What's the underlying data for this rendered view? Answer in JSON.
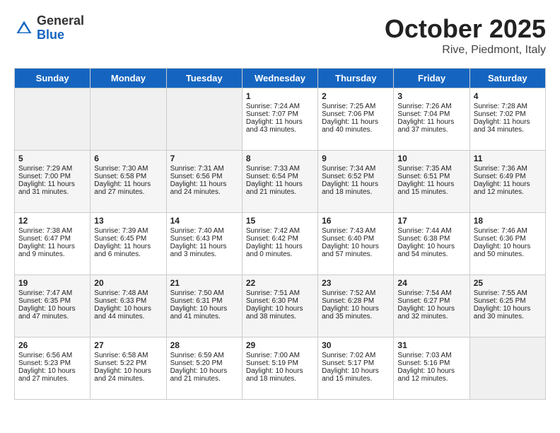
{
  "header": {
    "logo_general": "General",
    "logo_blue": "Blue",
    "month_title": "October 2025",
    "location": "Rive, Piedmont, Italy"
  },
  "days_of_week": [
    "Sunday",
    "Monday",
    "Tuesday",
    "Wednesday",
    "Thursday",
    "Friday",
    "Saturday"
  ],
  "weeks": [
    {
      "cells": [
        {
          "empty": true
        },
        {
          "empty": true
        },
        {
          "empty": true
        },
        {
          "day": 1,
          "sunrise": "7:24 AM",
          "sunset": "7:07 PM",
          "daylight": "11 hours and 43 minutes."
        },
        {
          "day": 2,
          "sunrise": "7:25 AM",
          "sunset": "7:06 PM",
          "daylight": "11 hours and 40 minutes."
        },
        {
          "day": 3,
          "sunrise": "7:26 AM",
          "sunset": "7:04 PM",
          "daylight": "11 hours and 37 minutes."
        },
        {
          "day": 4,
          "sunrise": "7:28 AM",
          "sunset": "7:02 PM",
          "daylight": "11 hours and 34 minutes."
        }
      ]
    },
    {
      "cells": [
        {
          "day": 5,
          "sunrise": "7:29 AM",
          "sunset": "7:00 PM",
          "daylight": "11 hours and 31 minutes."
        },
        {
          "day": 6,
          "sunrise": "7:30 AM",
          "sunset": "6:58 PM",
          "daylight": "11 hours and 27 minutes."
        },
        {
          "day": 7,
          "sunrise": "7:31 AM",
          "sunset": "6:56 PM",
          "daylight": "11 hours and 24 minutes."
        },
        {
          "day": 8,
          "sunrise": "7:33 AM",
          "sunset": "6:54 PM",
          "daylight": "11 hours and 21 minutes."
        },
        {
          "day": 9,
          "sunrise": "7:34 AM",
          "sunset": "6:52 PM",
          "daylight": "11 hours and 18 minutes."
        },
        {
          "day": 10,
          "sunrise": "7:35 AM",
          "sunset": "6:51 PM",
          "daylight": "11 hours and 15 minutes."
        },
        {
          "day": 11,
          "sunrise": "7:36 AM",
          "sunset": "6:49 PM",
          "daylight": "11 hours and 12 minutes."
        }
      ]
    },
    {
      "cells": [
        {
          "day": 12,
          "sunrise": "7:38 AM",
          "sunset": "6:47 PM",
          "daylight": "11 hours and 9 minutes."
        },
        {
          "day": 13,
          "sunrise": "7:39 AM",
          "sunset": "6:45 PM",
          "daylight": "11 hours and 6 minutes."
        },
        {
          "day": 14,
          "sunrise": "7:40 AM",
          "sunset": "6:43 PM",
          "daylight": "11 hours and 3 minutes."
        },
        {
          "day": 15,
          "sunrise": "7:42 AM",
          "sunset": "6:42 PM",
          "daylight": "11 hours and 0 minutes."
        },
        {
          "day": 16,
          "sunrise": "7:43 AM",
          "sunset": "6:40 PM",
          "daylight": "10 hours and 57 minutes."
        },
        {
          "day": 17,
          "sunrise": "7:44 AM",
          "sunset": "6:38 PM",
          "daylight": "10 hours and 54 minutes."
        },
        {
          "day": 18,
          "sunrise": "7:46 AM",
          "sunset": "6:36 PM",
          "daylight": "10 hours and 50 minutes."
        }
      ]
    },
    {
      "cells": [
        {
          "day": 19,
          "sunrise": "7:47 AM",
          "sunset": "6:35 PM",
          "daylight": "10 hours and 47 minutes."
        },
        {
          "day": 20,
          "sunrise": "7:48 AM",
          "sunset": "6:33 PM",
          "daylight": "10 hours and 44 minutes."
        },
        {
          "day": 21,
          "sunrise": "7:50 AM",
          "sunset": "6:31 PM",
          "daylight": "10 hours and 41 minutes."
        },
        {
          "day": 22,
          "sunrise": "7:51 AM",
          "sunset": "6:30 PM",
          "daylight": "10 hours and 38 minutes."
        },
        {
          "day": 23,
          "sunrise": "7:52 AM",
          "sunset": "6:28 PM",
          "daylight": "10 hours and 35 minutes."
        },
        {
          "day": 24,
          "sunrise": "7:54 AM",
          "sunset": "6:27 PM",
          "daylight": "10 hours and 32 minutes."
        },
        {
          "day": 25,
          "sunrise": "7:55 AM",
          "sunset": "6:25 PM",
          "daylight": "10 hours and 30 minutes."
        }
      ]
    },
    {
      "cells": [
        {
          "day": 26,
          "sunrise": "6:56 AM",
          "sunset": "5:23 PM",
          "daylight": "10 hours and 27 minutes."
        },
        {
          "day": 27,
          "sunrise": "6:58 AM",
          "sunset": "5:22 PM",
          "daylight": "10 hours and 24 minutes."
        },
        {
          "day": 28,
          "sunrise": "6:59 AM",
          "sunset": "5:20 PM",
          "daylight": "10 hours and 21 minutes."
        },
        {
          "day": 29,
          "sunrise": "7:00 AM",
          "sunset": "5:19 PM",
          "daylight": "10 hours and 18 minutes."
        },
        {
          "day": 30,
          "sunrise": "7:02 AM",
          "sunset": "5:17 PM",
          "daylight": "10 hours and 15 minutes."
        },
        {
          "day": 31,
          "sunrise": "7:03 AM",
          "sunset": "5:16 PM",
          "daylight": "10 hours and 12 minutes."
        },
        {
          "empty": true
        }
      ]
    }
  ]
}
